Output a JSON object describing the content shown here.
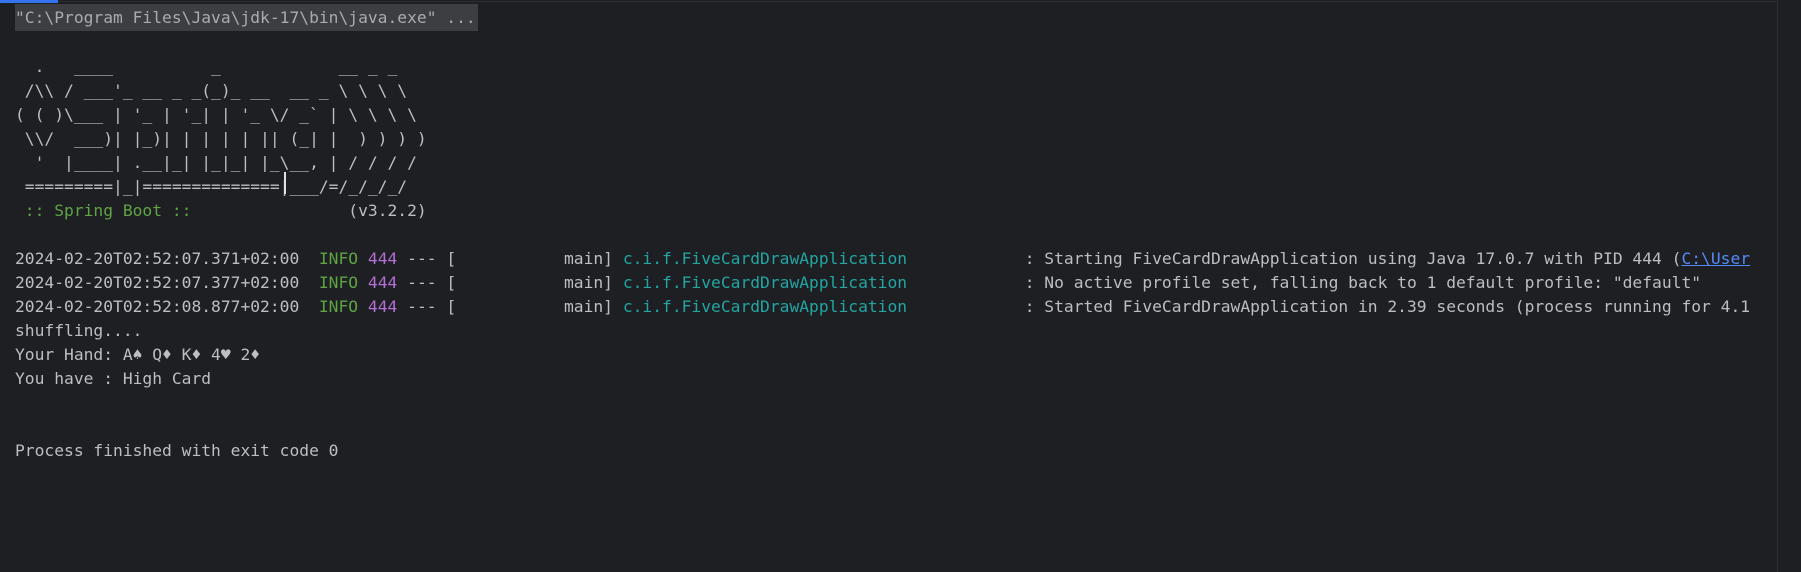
{
  "console": {
    "command": "\"C:\\Program Files\\Java\\jdk-17\\bin\\java.exe\" ...",
    "banner": [
      "  .   ____          _            __ _ _",
      " /\\\\ / ___'_ __ _ _(_)_ __  __ _ \\ \\ \\ \\",
      "( ( )\\___ | '_ | '_| | '_ \\/ _` | \\ \\ \\ \\",
      " \\\\/  ___)| |_)| | | | | || (_| |  ) ) ) )",
      "  '  |____| .__|_| |_|_| |_\\__, | / / / /",
      " =========|_|==============|___/=/_/_/_/"
    ],
    "spring_boot": {
      "label": " :: Spring Boot :: ",
      "version": "               (v3.2.2)"
    },
    "log_lines": [
      {
        "timestamp": "2024-02-20T02:52:07.371+02:00",
        "level": "INFO",
        "pid": "444",
        "thread": "--- [           main]",
        "logger": "c.i.f.FiveCardDrawApplication",
        "message": "            : Starting FiveCardDrawApplication using Java 17.0.7 with PID 444 (",
        "link": "C:\\User"
      },
      {
        "timestamp": "2024-02-20T02:52:07.377+02:00",
        "level": "INFO",
        "pid": "444",
        "thread": "--- [           main]",
        "logger": "c.i.f.FiveCardDrawApplication",
        "message": "            : No active profile set, falling back to 1 default profile: \"default\""
      },
      {
        "timestamp": "2024-02-20T02:52:08.877+02:00",
        "level": "INFO",
        "pid": "444",
        "thread": "--- [           main]",
        "logger": "c.i.f.FiveCardDrawApplication",
        "message": "            : Started FiveCardDrawApplication in 2.39 seconds (process running for 4.1"
      }
    ],
    "program_output": [
      "shuffling....",
      "Your Hand: A♠ Q♦ K♦ 4♥ 2♦",
      "You have : High Card"
    ],
    "exit_message": "Process finished with exit code 0"
  },
  "colors": {
    "background": "#1e1f22",
    "text": "#bcbec4",
    "info_green": "#5fa344",
    "pid_purple": "#b46fd4",
    "logger_teal": "#22a5a3",
    "link_blue": "#548af7"
  }
}
